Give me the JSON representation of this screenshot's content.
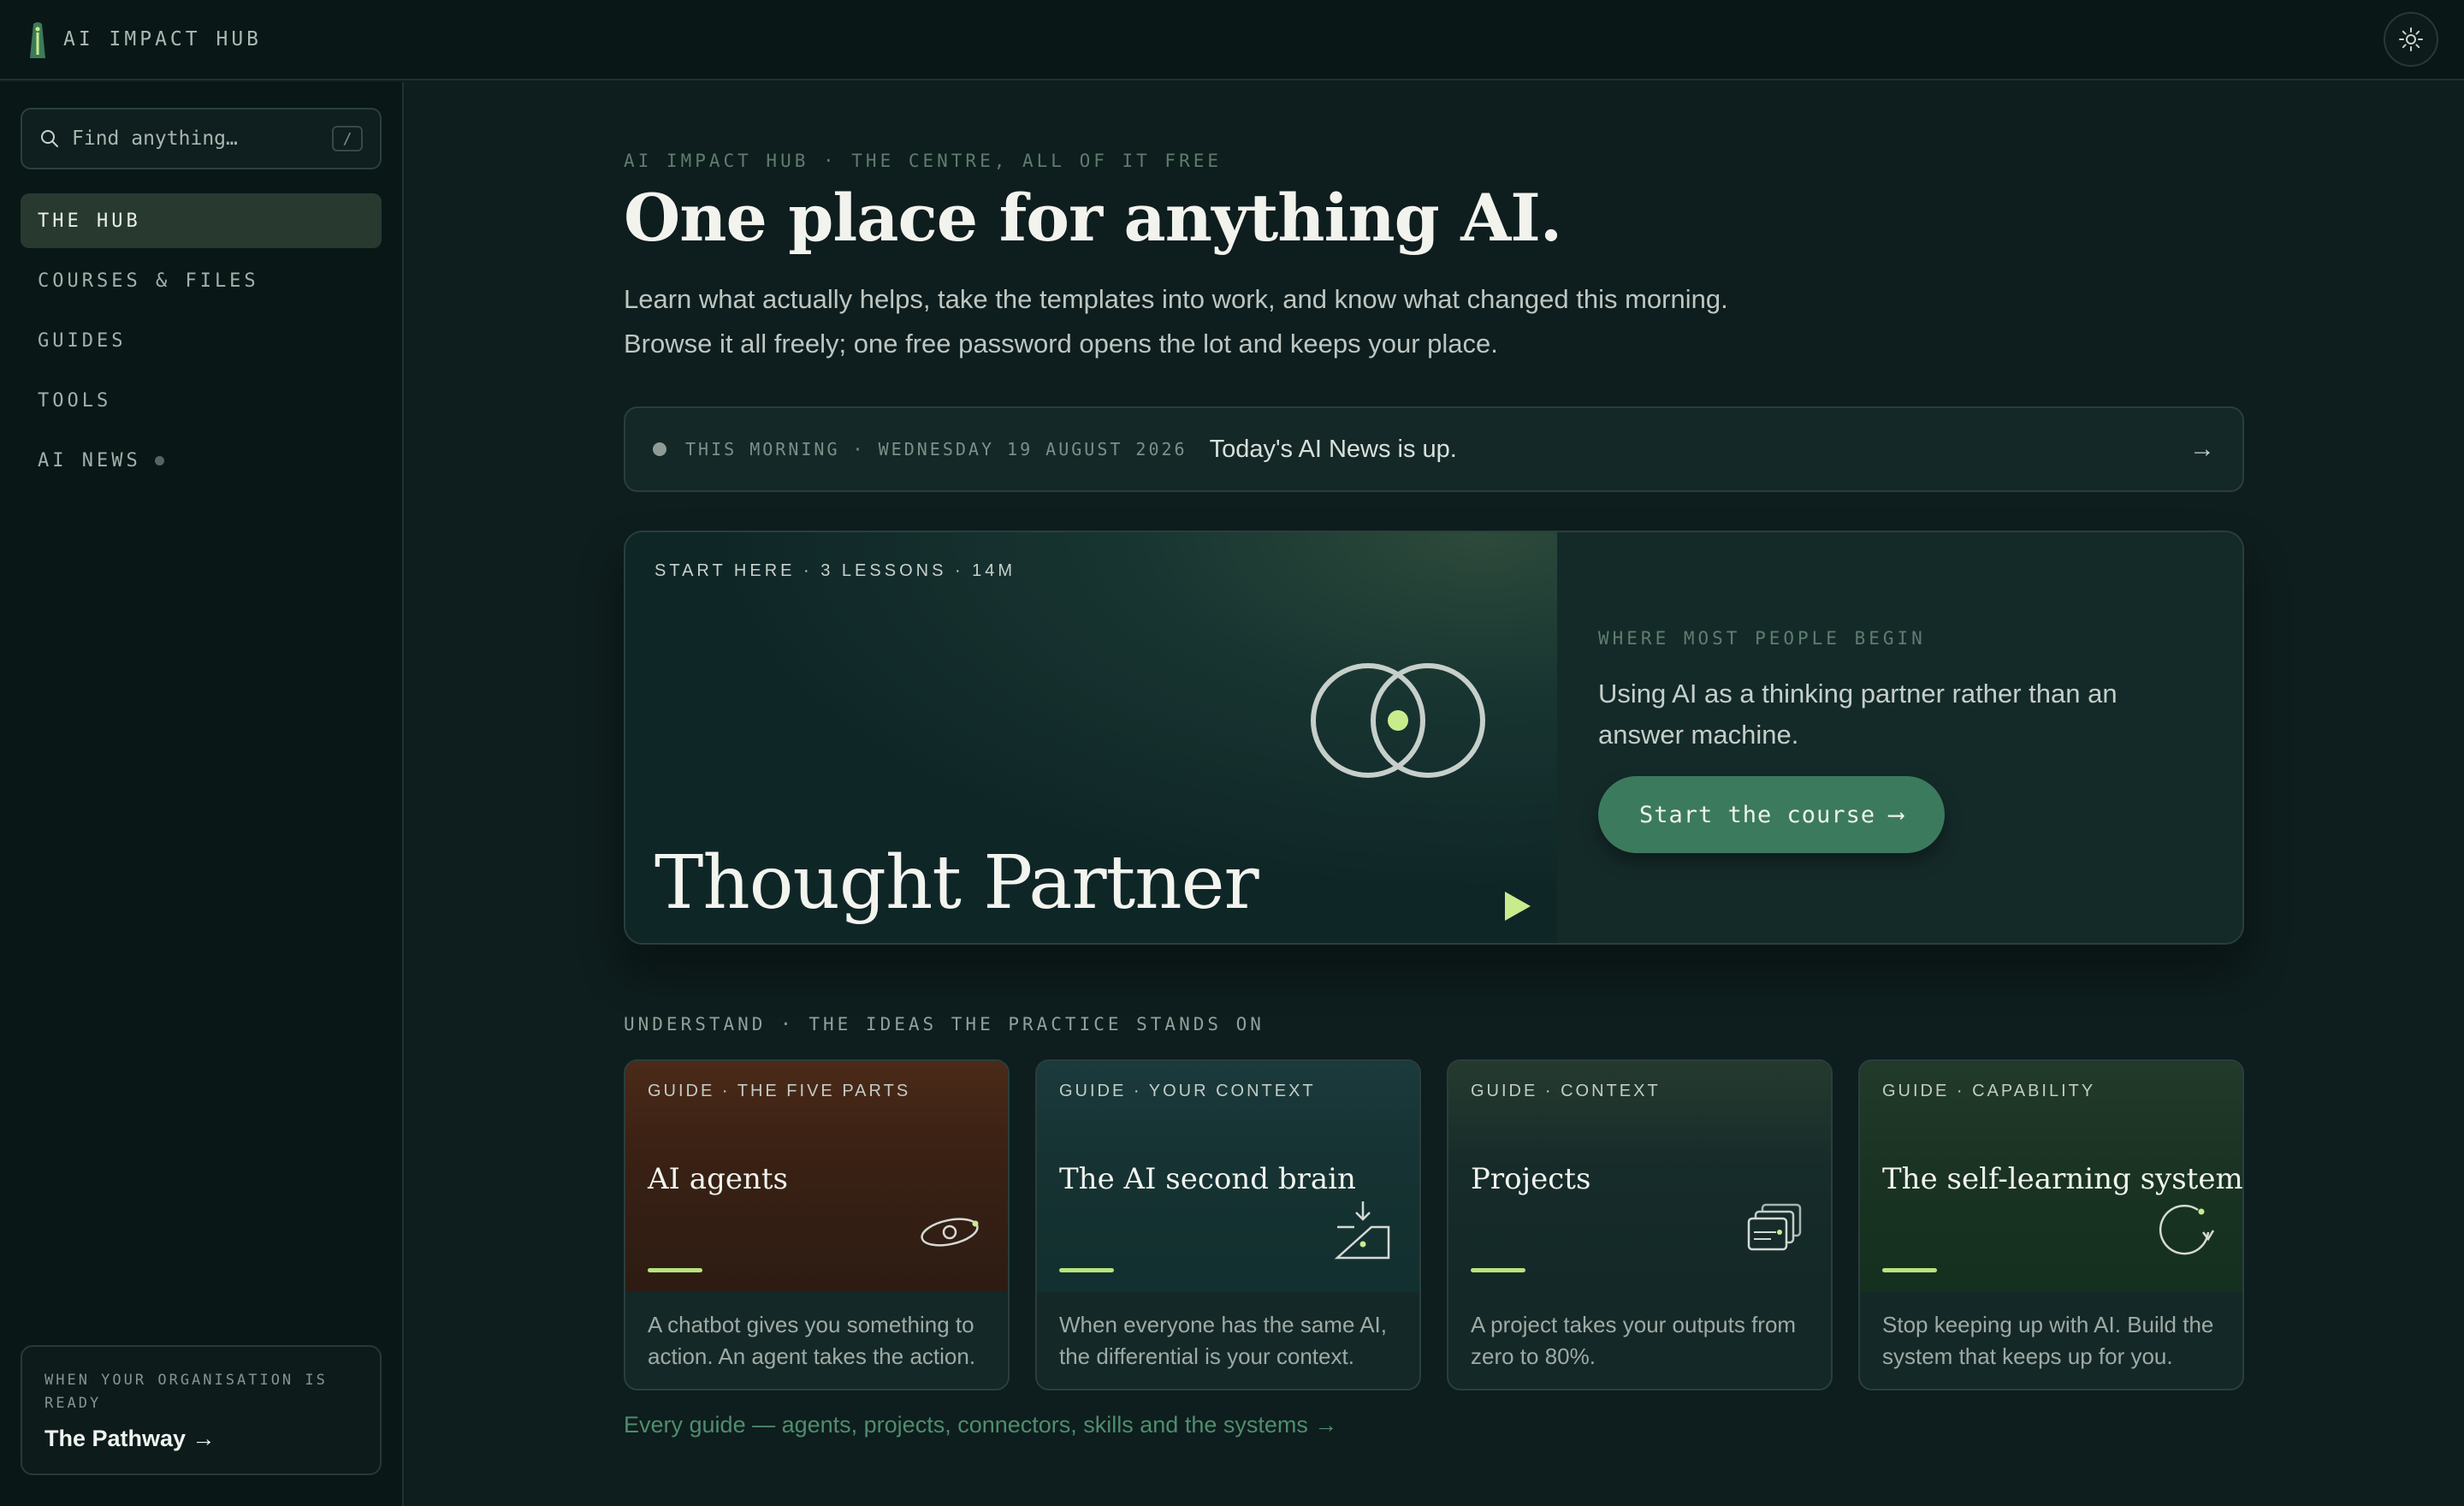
{
  "app": {
    "brand": "AI IMPACT HUB"
  },
  "sidebar": {
    "search_placeholder": "Find anything…",
    "search_shortcut": "/",
    "items": [
      {
        "label": "THE HUB"
      },
      {
        "label": "COURSES & FILES"
      },
      {
        "label": "GUIDES"
      },
      {
        "label": "TOOLS"
      },
      {
        "label": "AI NEWS"
      }
    ],
    "pathway": {
      "caption": "WHEN YOUR ORGANISATION IS READY",
      "label": "The Pathway →"
    }
  },
  "main": {
    "eyebrow": "AI IMPACT HUB · THE CENTRE, ALL OF IT FREE",
    "headline": "One place for anything AI.",
    "lede_line1": "Learn what actually helps, take the templates into work, and know what changed this morning.",
    "lede_line2": "Browse it all freely; one free password opens the lot and keeps your place.",
    "news": {
      "date": "THIS MORNING · WEDNESDAY 19 AUGUST 2026",
      "message": "Today's AI News is up.",
      "arrow": "→"
    },
    "hero": {
      "tag": "START HERE · 3 LESSONS · 14M",
      "title": "Thought Partner",
      "right_eyebrow": "WHERE MOST PEOPLE BEGIN",
      "right_text": "Using AI as a thinking partner rather than an answer machine.",
      "button_label": "Start the course",
      "button_arrow": "⟶"
    },
    "section_label": "UNDERSTAND · THE IDEAS THE PRACTICE STANDS ON",
    "cards": [
      {
        "tag": "GUIDE · THE FIVE PARTS",
        "title": "AI agents",
        "desc": "A chatbot gives you something to action. An agent takes the action.",
        "icon": "orbit-icon"
      },
      {
        "tag": "GUIDE · YOUR CONTEXT",
        "title": "The AI second brain",
        "desc": "When everyone has the same AI, the differential is your context.",
        "icon": "inbox-download-icon"
      },
      {
        "tag": "GUIDE · CONTEXT",
        "title": "Projects",
        "desc": "A project takes your outputs from zero to 80%.",
        "icon": "stacked-cards-icon"
      },
      {
        "tag": "GUIDE · CAPABILITY",
        "title": "The self-learning system",
        "desc": "Stop keeping up with AI. Build the system that keeps up for you.",
        "icon": "cycle-icon"
      }
    ],
    "all_guides_link": "Every guide — agents, projects, connectors, skills and the systems →"
  },
  "colors": {
    "background": "#0e1d1d",
    "accent": "#3c7a5d",
    "highlight": "#c8ec8c"
  }
}
